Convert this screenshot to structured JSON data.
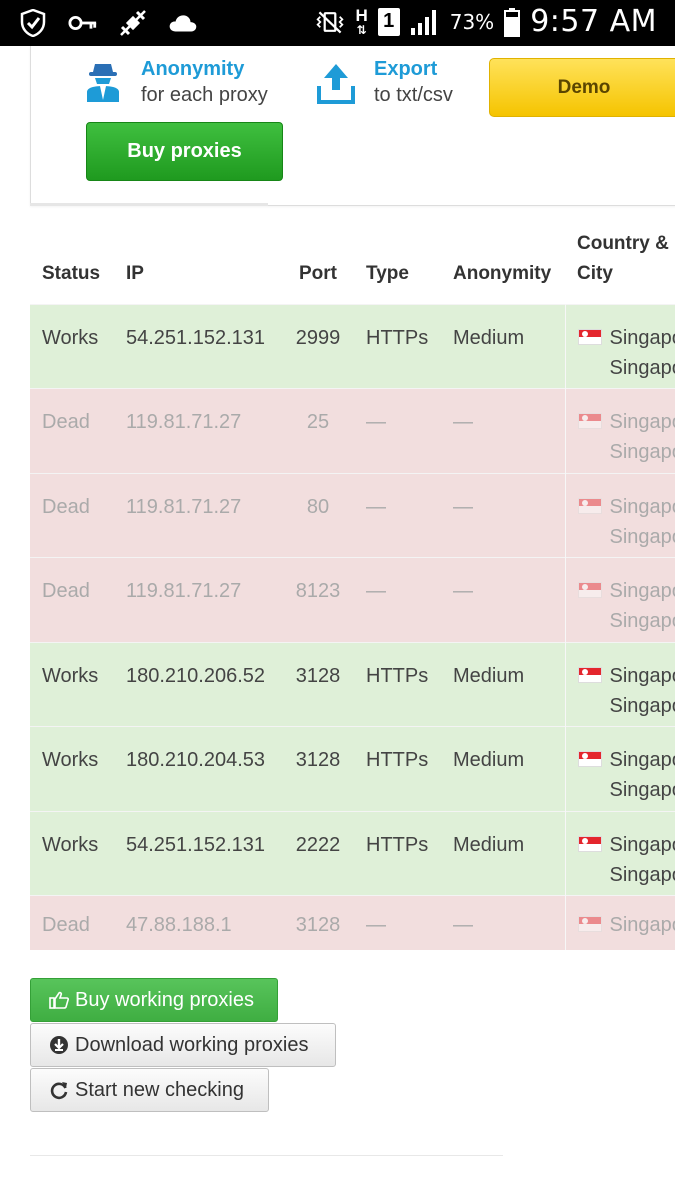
{
  "status_bar": {
    "battery_percent": "73%",
    "time": "9:57 AM",
    "network_letter": "H",
    "sim_number": "1",
    "icons_left": [
      "shield-check-icon",
      "key-icon",
      "satellite-icon",
      "cloud-icon"
    ],
    "icons_right": [
      "vibrate-mute-icon",
      "h-network-icon",
      "sim-1-icon",
      "signal-icon",
      "battery-icon"
    ]
  },
  "promo": {
    "anonymity_title": "Anonymity",
    "anonymity_sub": "for each proxy",
    "export_title": "Export",
    "export_sub": "to txt/csv",
    "demo_label": "Demo",
    "buy_label": "Buy proxies"
  },
  "table": {
    "headers": {
      "status": "Status",
      "ip": "IP",
      "port": "Port",
      "type": "Type",
      "anonymity": "Anonymity",
      "country_line1": "Country &",
      "country_line2": "City"
    },
    "rows": [
      {
        "status": "Works",
        "ip": "54.251.152.131",
        "port": "2999",
        "type": "HTTPs",
        "anonymity": "Medium",
        "country": "Singapo",
        "city": "Singapo"
      },
      {
        "status": "Dead",
        "ip": "119.81.71.27",
        "port": "25",
        "type": "—",
        "anonymity": "—",
        "country": "Singapo",
        "city": "Singapo"
      },
      {
        "status": "Dead",
        "ip": "119.81.71.27",
        "port": "80",
        "type": "—",
        "anonymity": "—",
        "country": "Singapo",
        "city": "Singapo"
      },
      {
        "status": "Dead",
        "ip": "119.81.71.27",
        "port": "8123",
        "type": "—",
        "anonymity": "—",
        "country": "Singapo",
        "city": "Singapo"
      },
      {
        "status": "Works",
        "ip": "180.210.206.52",
        "port": "3128",
        "type": "HTTPs",
        "anonymity": "Medium",
        "country": "Singapo",
        "city": "Singapo"
      },
      {
        "status": "Works",
        "ip": "180.210.204.53",
        "port": "3128",
        "type": "HTTPs",
        "anonymity": "Medium",
        "country": "Singapo",
        "city": "Singapo"
      },
      {
        "status": "Works",
        "ip": "54.251.152.131",
        "port": "2222",
        "type": "HTTPs",
        "anonymity": "Medium",
        "country": "Singapo",
        "city": "Singapo"
      },
      {
        "status": "Dead",
        "ip": "47.88.188.1",
        "port": "3128",
        "type": "—",
        "anonymity": "—",
        "country": "Singapo",
        "city": ""
      }
    ]
  },
  "actions": {
    "buy_working": "Buy working proxies",
    "download_working": "Download working proxies",
    "start_new": "Start new checking"
  },
  "colors": {
    "works_row": "#dff0d8",
    "dead_row": "#f2dede",
    "accent_blue": "#1e9bd7",
    "buy_green": "#2aa72a",
    "demo_yellow": "#fdd835"
  }
}
